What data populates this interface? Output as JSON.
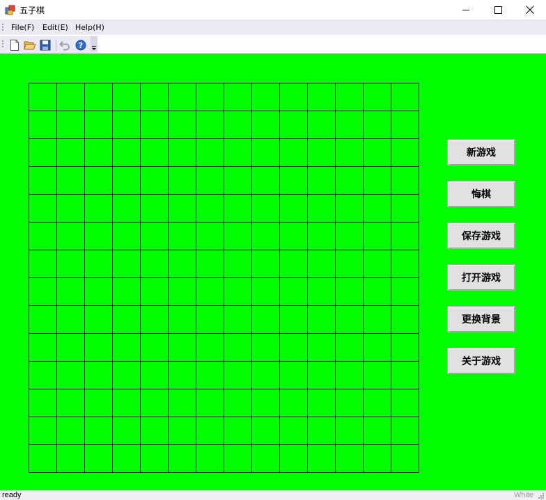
{
  "window": {
    "title": "五子棋"
  },
  "menubar": {
    "items": [
      "File(F)",
      "Edit(E)",
      "Help(H)"
    ]
  },
  "toolbar": {
    "buttons": [
      "new-file-icon",
      "open-folder-icon",
      "save-icon",
      "undo-icon",
      "help-icon"
    ]
  },
  "board": {
    "rows": 14,
    "cols": 14,
    "background": "#00ff00",
    "line_color": "#000000"
  },
  "side_buttons": [
    "新游戏",
    "悔棋",
    "保存游戏",
    "打开游戏",
    "更换背景",
    "关于游戏"
  ],
  "status": {
    "left": "ready",
    "right": "White"
  }
}
